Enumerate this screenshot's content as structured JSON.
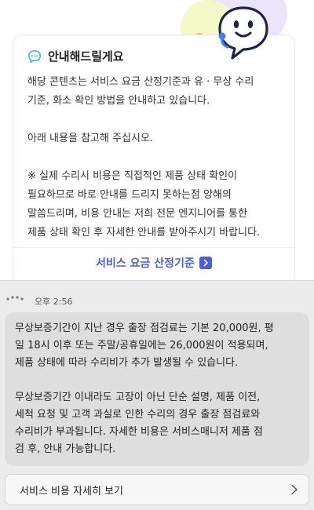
{
  "info_card": {
    "title": "안내해드릴게요",
    "body": "해당 콘텐츠는 서비스 요금 산정기준과 유 · 무상 수리\n기준, 화소 확인 방법을 안내하고 있습니다.\n\n아래 내용을 참고해 주십시오.\n\n※ 실제 수리시 비용은 직접적인 제품 상태 확인이\n필요하므로 바로 안내를 드리지 못하는점 양해의\n말씀드리며, 비용 안내는 저희 전문 엔지니어를 통한\n제품 상태 확인 후 자세한 안내를 받아주시기 바랍니다.",
    "link_label": "서비스 요금 산정기준"
  },
  "message": {
    "time": "오후 2:56",
    "text": "무상보증기간이 지난 경우 출장 점검료는 기본 20,000원, 평\n일 18시 이후 또는 주말/공휴일에는 26,000원이 적용되며,\n제품 상태에 따라 수리비가 추가 발생될 수 있습니다.\n\n무상보증기간 이내라도 고장이 아닌 단순 설명, 제품 이전,\n세척 요청 및 고객 과실로 인한 수리의 경우 출장 점검료와\n수리비가 부과됩니다. 자세한 비용은 서비스매니저 제품 점\n검 후, 안내 가능합니다."
  },
  "service_button": {
    "label": "서비스 비용 자세히 보기"
  },
  "colors": {
    "accent": "#4a5ed8",
    "chat_icon": "#3fb7d6",
    "bubble_bg": "#dedede",
    "bottom_bg": "#ececec"
  }
}
